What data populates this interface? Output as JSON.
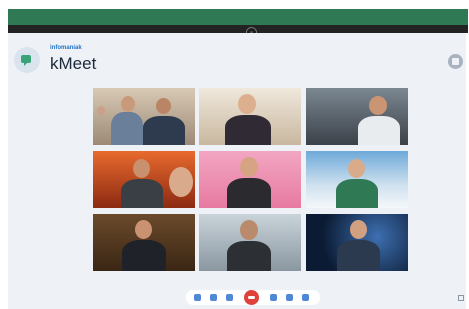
{
  "app": {
    "brand_sub": "infomaniak",
    "title": "kMeet"
  },
  "colors": {
    "accent": "#2f7a55",
    "brand_blue": "#2473c6",
    "end_call": "#e0403a",
    "control_icon": "#4f89d6"
  },
  "video_grid": {
    "rows": 3,
    "columns": 3,
    "participants": [
      {
        "scene": "office-two-people"
      },
      {
        "scene": "home-woman"
      },
      {
        "scene": "car-man"
      },
      {
        "scene": "fire-background"
      },
      {
        "scene": "cartoon-living-room"
      },
      {
        "scene": "mountains"
      },
      {
        "scene": "wine-cellar"
      },
      {
        "scene": "foggy-road"
      },
      {
        "scene": "space-earth"
      }
    ]
  },
  "controls": [
    {
      "icon": "microphone-icon"
    },
    {
      "icon": "camera-icon"
    },
    {
      "icon": "screen-share-icon"
    },
    {
      "icon": "end-call-icon"
    },
    {
      "icon": "share-icon"
    },
    {
      "icon": "hand-icon"
    },
    {
      "icon": "lock-icon"
    }
  ]
}
